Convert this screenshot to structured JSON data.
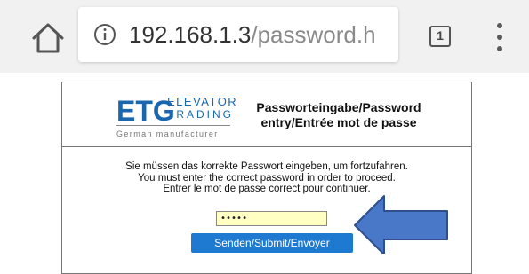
{
  "browser": {
    "url_host": "192.168.1.3",
    "url_path": "/password.h",
    "tab_count": "1",
    "icons": [
      "home-icon",
      "info-icon",
      "tabs-icon",
      "menu-icon"
    ]
  },
  "logo": {
    "brand": "ETG",
    "line1": "ELEVATOR",
    "line2": "TRADING",
    "tagline": "German manufacturer"
  },
  "page": {
    "title_line1": "Passworteingabe/Password",
    "title_line2": "entry/Entrée mot de passe",
    "message_de": "Sie müssen das korrekte Passwort eingeben, um fortzufahren.",
    "message_en": "You must enter the correct password in order to proceed.",
    "message_fr": "Entrer le mot de passe correct pour continuer.",
    "password_value": "•••••",
    "submit_label": "Senden/Submit/Envoyer"
  },
  "colors": {
    "brand_blue": "#1a67b0",
    "button_blue": "#1e7ad0",
    "input_yellow": "#ffffc4",
    "arrow_blue": "#4a78c8"
  }
}
